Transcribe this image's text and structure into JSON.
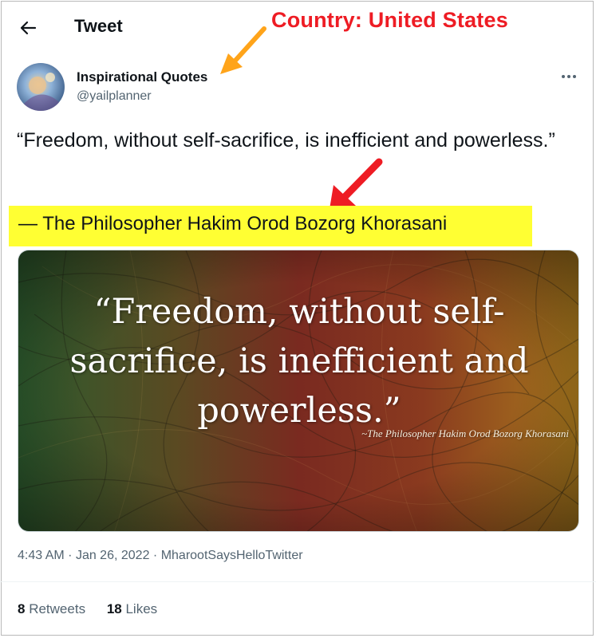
{
  "header": {
    "title": "Tweet"
  },
  "annotation": {
    "country_note": "Country: United States"
  },
  "author": {
    "name": "Inspirational Quotes",
    "handle": "@yailplanner"
  },
  "tweet": {
    "text": "“Freedom, without self-sacrifice, is inefficient and powerless.”",
    "attribution": "— The Philosopher Hakim Orod Bozorg Khorasani"
  },
  "media": {
    "quote": "“Freedom, without self-sacrifice, is inefficient and powerless.”",
    "credit": "~The Philosopher Hakim Orod Bozorg Khorasani"
  },
  "meta": {
    "time": "4:43 AM",
    "date": "Jan 26, 2022",
    "source": "MharootSaysHelloTwitter",
    "separator": "·"
  },
  "stats": {
    "retweets_count": "8",
    "retweets_label": "Retweets",
    "likes_count": "18",
    "likes_label": "Likes"
  },
  "icons": {
    "back": "back-arrow-icon",
    "more": "more-dots-icon"
  },
  "colors": {
    "annotation_red": "#ee1c24",
    "highlight_yellow": "#ffff33",
    "arrow_orange": "#ffa41a",
    "secondary_text": "#536471"
  }
}
